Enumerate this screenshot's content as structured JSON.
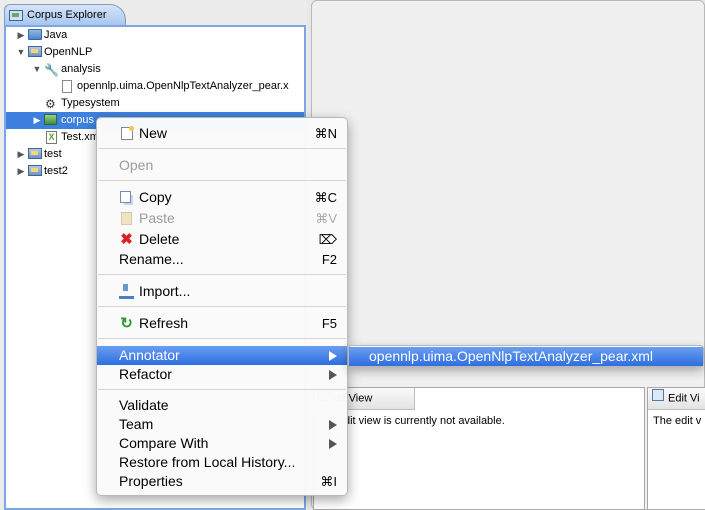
{
  "explorer": {
    "title": "Corpus Explorer",
    "tree": [
      {
        "label": "Java",
        "icon": "folder-icon",
        "indent": 0,
        "expanded": false
      },
      {
        "label": "OpenNLP",
        "icon": "project-icon",
        "indent": 0,
        "expanded": true
      },
      {
        "label": "analysis",
        "icon": "wrench-icon",
        "indent": 1,
        "expanded": true
      },
      {
        "label": "opennlp.uima.OpenNlpTextAnalyzer_pear.x",
        "icon": "file-icon",
        "indent": 2,
        "expanded": null
      },
      {
        "label": "Typesystem",
        "icon": "typesystem-icon",
        "indent": 1,
        "expanded": null
      },
      {
        "label": "corpus",
        "icon": "corpus-icon",
        "indent": 1,
        "expanded": false,
        "selected": true
      },
      {
        "label": "Test.xm",
        "icon": "xml-file-icon",
        "indent": 1,
        "expanded": null
      },
      {
        "label": "test",
        "icon": "project-icon",
        "indent": 0,
        "expanded": false
      },
      {
        "label": "test2",
        "icon": "project-icon",
        "indent": 0,
        "expanded": false
      }
    ]
  },
  "edit_views": [
    {
      "tab": "dit View",
      "text": "dit view is currently not available."
    },
    {
      "tab": "Edit Vi",
      "text": "The edit v"
    }
  ],
  "menu": {
    "new": {
      "label": "New",
      "shortcut": "⌘N"
    },
    "open": {
      "label": "Open"
    },
    "copy": {
      "label": "Copy",
      "shortcut": "⌘C"
    },
    "paste": {
      "label": "Paste",
      "shortcut": "⌘V"
    },
    "delete": {
      "label": "Delete",
      "shortcut": "⌦"
    },
    "rename": {
      "label": "Rename...",
      "shortcut": "F2"
    },
    "import": {
      "label": "Import..."
    },
    "refresh": {
      "label": "Refresh",
      "shortcut": "F5"
    },
    "annotator": {
      "label": "Annotator"
    },
    "refactor": {
      "label": "Refactor"
    },
    "validate": {
      "label": "Validate"
    },
    "team": {
      "label": "Team"
    },
    "compare": {
      "label": "Compare With"
    },
    "restore": {
      "label": "Restore from Local History..."
    },
    "properties": {
      "label": "Properties",
      "shortcut": "⌘I"
    }
  },
  "submenu": {
    "item": "opennlp.uima.OpenNlpTextAnalyzer_pear.xml"
  },
  "colors": {
    "selection": "#3d80df",
    "menu_highlight": "#2d6ee0"
  }
}
